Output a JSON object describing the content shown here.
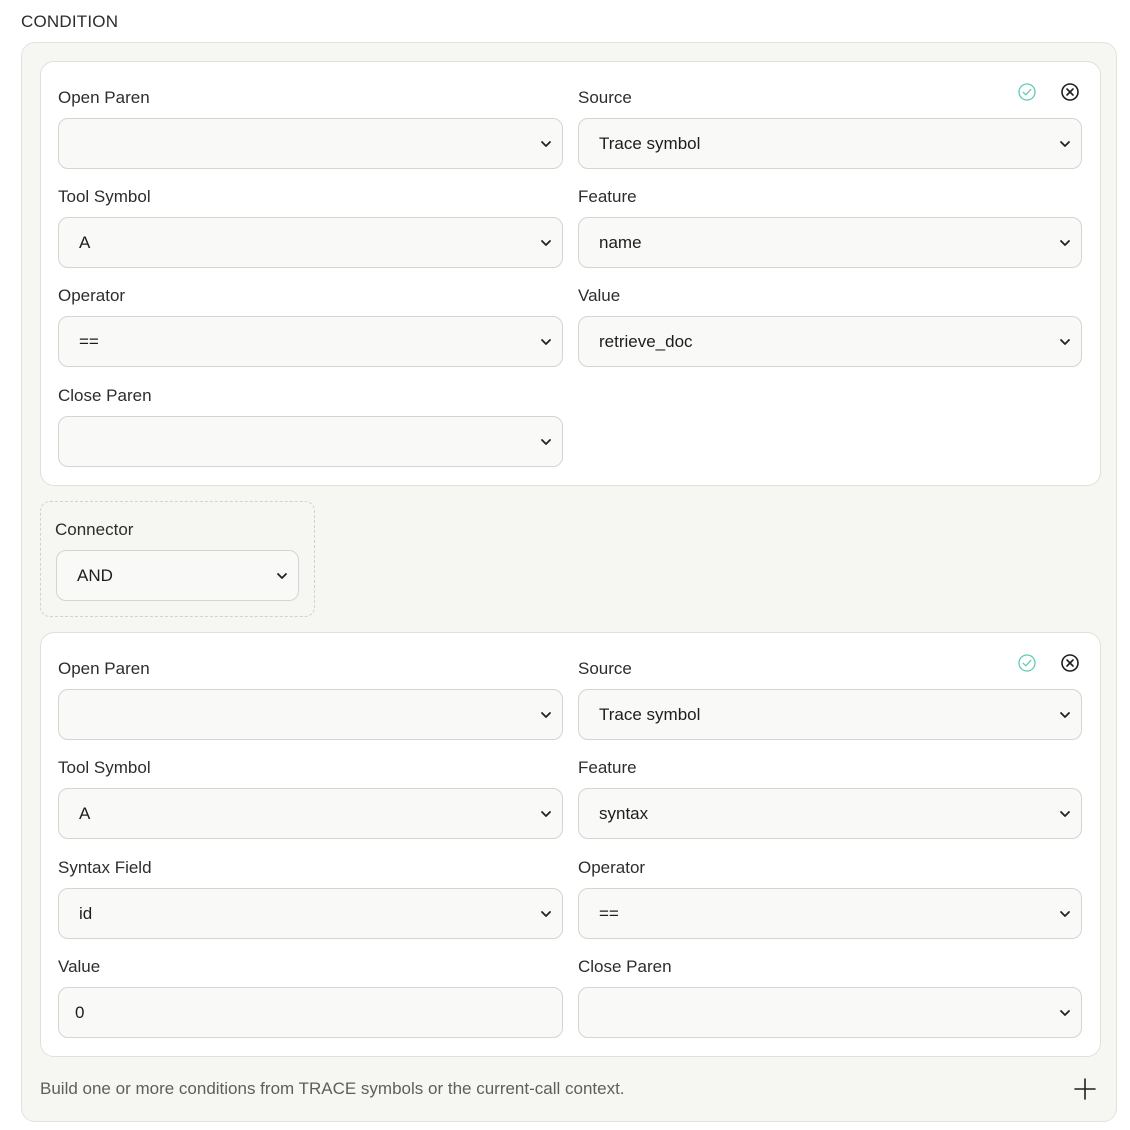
{
  "section": {
    "title": "CONDITION"
  },
  "condition1": {
    "open_paren": {
      "label": "Open Paren",
      "value": ""
    },
    "source": {
      "label": "Source",
      "value": "Trace symbol"
    },
    "tool_symbol": {
      "label": "Tool Symbol",
      "value": "A"
    },
    "feature": {
      "label": "Feature",
      "value": "name"
    },
    "operator": {
      "label": "Operator",
      "value": "=="
    },
    "value": {
      "label": "Value",
      "value": "retrieve_doc"
    },
    "close_paren": {
      "label": "Close Paren",
      "value": ""
    }
  },
  "connector": {
    "label": "Connector",
    "value": "AND"
  },
  "condition2": {
    "open_paren": {
      "label": "Open Paren",
      "value": ""
    },
    "source": {
      "label": "Source",
      "value": "Trace symbol"
    },
    "tool_symbol": {
      "label": "Tool Symbol",
      "value": "A"
    },
    "feature": {
      "label": "Feature",
      "value": "syntax"
    },
    "syntax_field": {
      "label": "Syntax Field",
      "value": "id"
    },
    "operator": {
      "label": "Operator",
      "value": "=="
    },
    "value": {
      "label": "Value",
      "value": "0"
    },
    "close_paren": {
      "label": "Close Paren",
      "value": ""
    }
  },
  "footer": {
    "help_text": "Build one or more conditions from TRACE symbols or the current-call context."
  },
  "icons": {
    "confirm": "check-circle-icon",
    "remove": "close-circle-icon",
    "dropdown": "chevron-down-icon",
    "add": "plus-icon"
  },
  "colors": {
    "confirm_accent": "#63c9b7",
    "panel_bg": "#f6f7f3",
    "field_bg": "#f9f9f7"
  }
}
